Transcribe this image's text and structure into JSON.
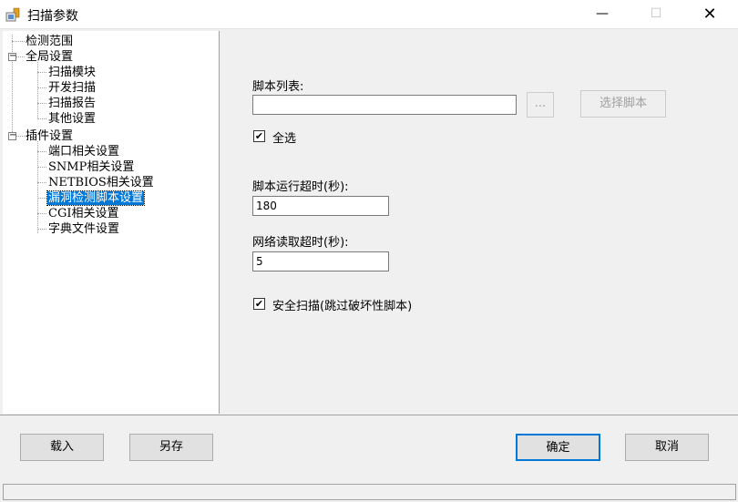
{
  "window": {
    "title": "扫描参数",
    "icon": "scan-app-icon",
    "controls": {
      "minimize": "—",
      "maximize": "☐",
      "close": "✕"
    }
  },
  "tree": {
    "items": [
      {
        "label": "检测范围"
      },
      {
        "label": "全局设置",
        "toggle": "−"
      },
      {
        "label": "扫描模块"
      },
      {
        "label": "开发扫描"
      },
      {
        "label": "扫描报告"
      },
      {
        "label": "其他设置"
      },
      {
        "label": "插件设置",
        "toggle": "−"
      },
      {
        "label": "端口相关设置"
      },
      {
        "label": "SNMP相关设置"
      },
      {
        "label": "NETBIOS相关设置"
      },
      {
        "label": "漏洞检测脚本设置",
        "selected": true
      },
      {
        "label": "CGI相关设置"
      },
      {
        "label": "字典文件设置"
      }
    ]
  },
  "form": {
    "script_list_label": "脚本列表:",
    "script_list_value": "",
    "browse_label": "...",
    "select_script_label": "选择脚本",
    "select_all_label": "全选",
    "select_all_checked": true,
    "timeout_label": "脚本运行超时(秒):",
    "timeout_value": "180",
    "net_timeout_label": "网络读取超时(秒):",
    "net_timeout_value": "5",
    "safe_scan_label": "安全扫描(跳过破坏性脚本)",
    "safe_scan_checked": true
  },
  "footer": {
    "load_label": "载入",
    "save_as_label": "另存",
    "ok_label": "确定",
    "cancel_label": "取消"
  },
  "glyphs": {
    "check": "✔"
  }
}
